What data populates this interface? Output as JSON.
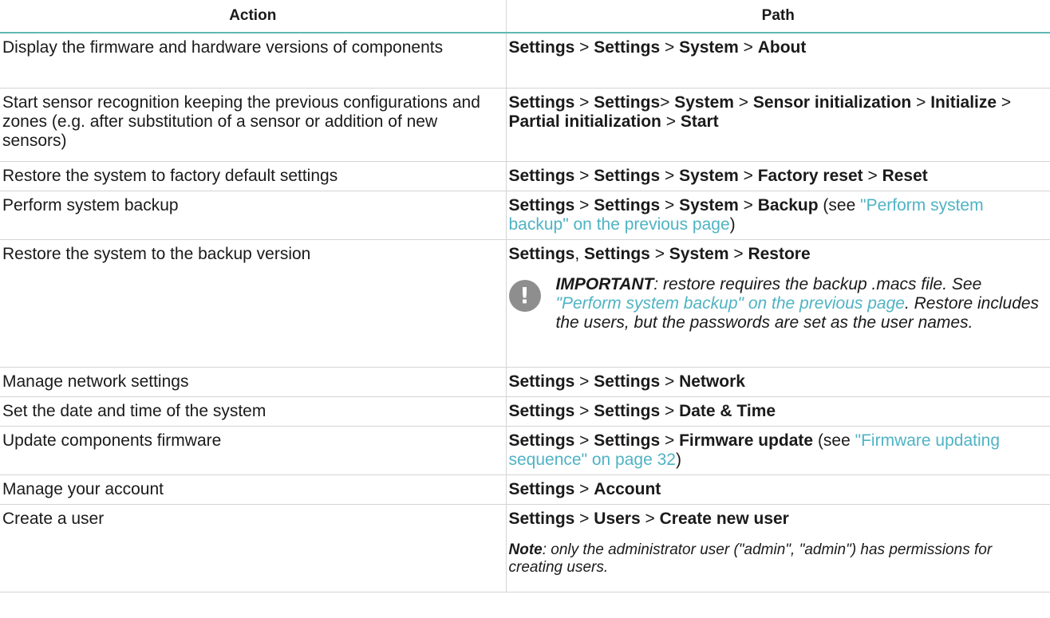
{
  "headers": {
    "action": "Action",
    "path": "Path"
  },
  "rows": [
    {
      "action": "Display the firmware and hardware versions of components"
    },
    {
      "action": "Start sensor recognition keeping the previous configurations and zones (e.g. after substitution of a sensor or addition of new sensors)"
    },
    {
      "action": "Restore the system to factory default settings"
    },
    {
      "action": "Perform system backup"
    },
    {
      "action": "Restore the system to the backup version"
    },
    {
      "action": "Manage network settings"
    },
    {
      "action": "Set the date and time of the system"
    },
    {
      "action": "Update components firmware"
    },
    {
      "action": "Manage your account"
    },
    {
      "action": "Create a user"
    }
  ],
  "paths": {
    "settings": "Settings",
    "system": "System",
    "about": "About",
    "sensor_init": "Sensor initialization",
    "initialize": "Initialize",
    "partial_init": "Partial initialization",
    "start": "Start",
    "factory_reset": "Factory reset",
    "reset": "Reset",
    "backup": "Backup",
    "restore": "Restore",
    "network": "Network",
    "date_time": "Date & Time",
    "firmware_update": "Firmware update",
    "account": "Account",
    "users": "Users",
    "create_new_user": "Create new user"
  },
  "links": {
    "backup_ref": "\"Perform system backup\" on the previous page",
    "firmware_ref": "\"Firmware updating sequence\" on page 32"
  },
  "notes": {
    "important_label": "IMPORTANT",
    "important_text_1": ": restore requires the backup .macs file. See ",
    "important_text_2": ". Restore includes the users, but the passwords are set as the user names.",
    "note_label": "Note",
    "note_text": ": only the administrator user (\"admin\", \"admin\") has permissions for creating users."
  },
  "icons": {
    "important": "exclamation-circle-icon"
  },
  "colors": {
    "header_rule": "#5fb8b4",
    "link": "#4fb3c4",
    "icon_bg": "#8e8e8e"
  }
}
